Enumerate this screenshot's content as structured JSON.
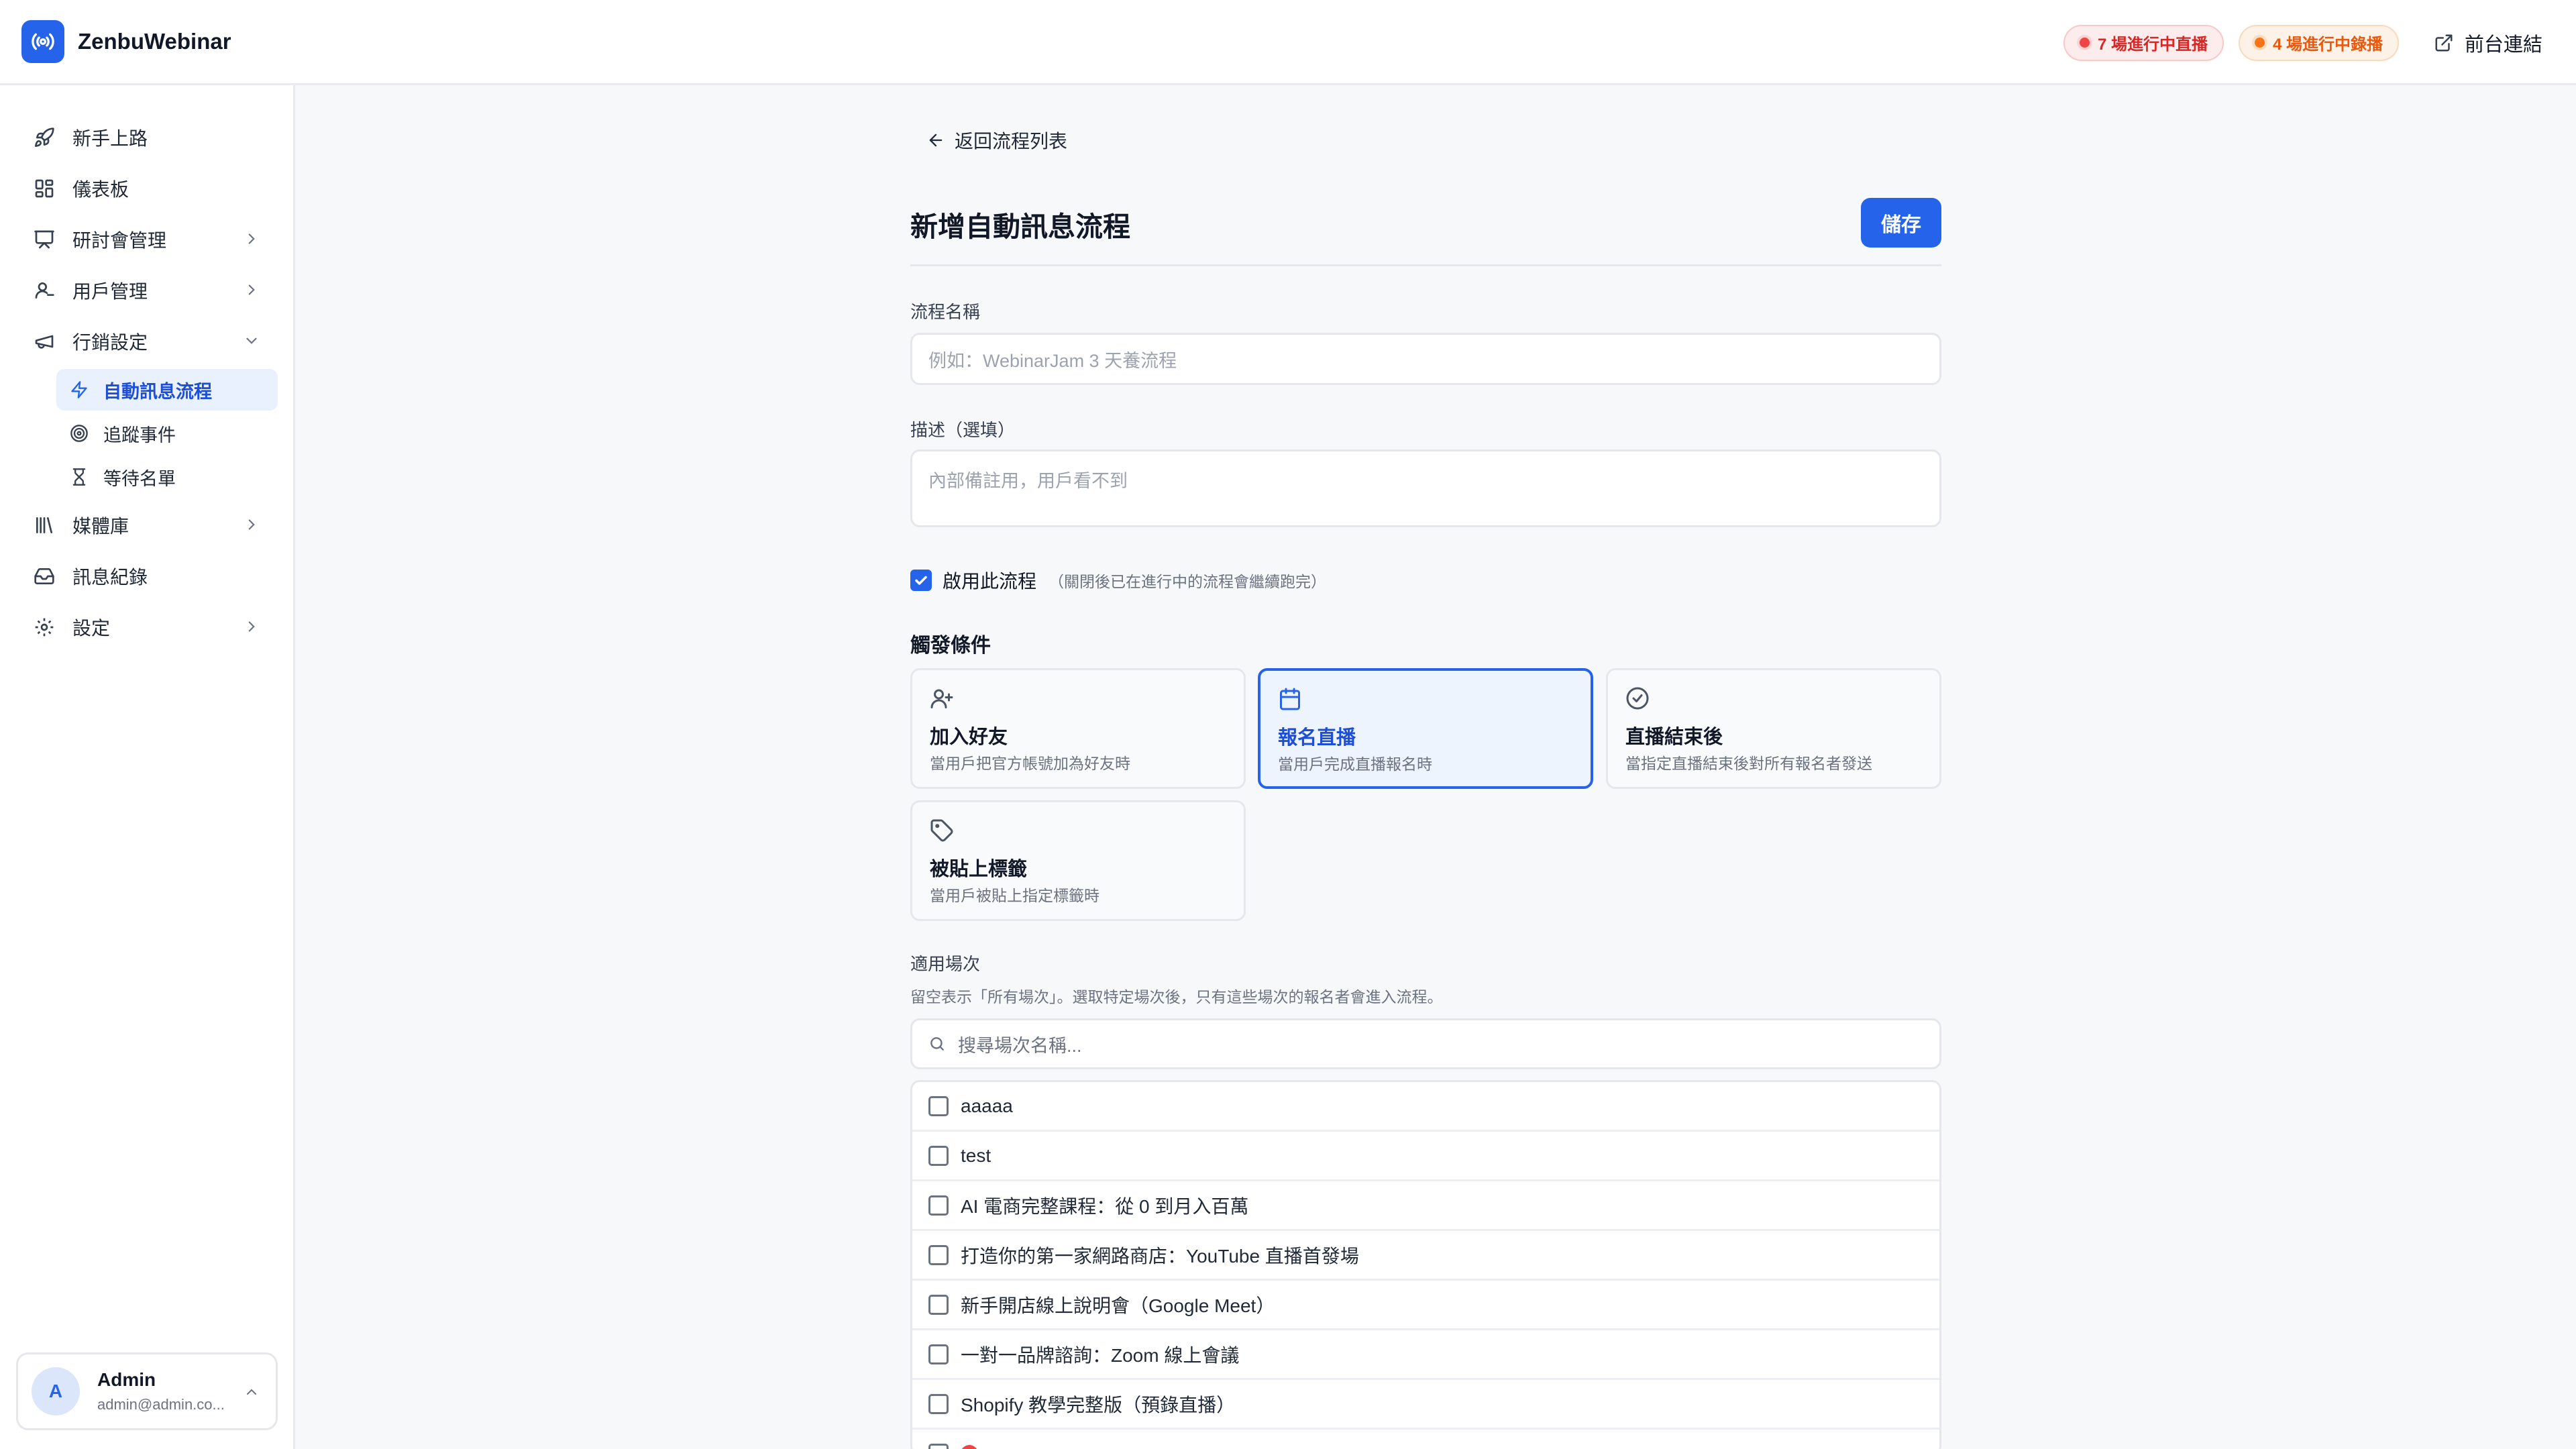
{
  "app": {
    "name": "ZenbuWebinar"
  },
  "header": {
    "live_badge": "7 場進行中直播",
    "recording_badge": "4 場進行中錄播",
    "front_link": "前台連結"
  },
  "sidebar": {
    "items": {
      "onboarding": "新手上路",
      "dashboard": "儀表板",
      "webinars": "研討會管理",
      "users": "用戶管理",
      "marketing": "行銷設定",
      "auto_flow": "自動訊息流程",
      "tracking": "追蹤事件",
      "waitlist": "等待名單",
      "media": "媒體庫",
      "messages": "訊息紀錄",
      "settings": "設定"
    },
    "user": {
      "initial": "A",
      "name": "Admin",
      "email": "admin@admin.co..."
    }
  },
  "page": {
    "back_label": "返回流程列表",
    "title": "新增自動訊息流程",
    "save_label": "儲存"
  },
  "form": {
    "name_label": "流程名稱",
    "name_placeholder": "例如：WebinarJam 3 天養流程",
    "desc_label": "描述（選填）",
    "desc_placeholder": "內部備註用，用戶看不到",
    "enable_label": "啟用此流程",
    "enable_checked": true,
    "enable_note": "（關閉後已在進行中的流程會繼續跑完）",
    "trigger_title": "觸發條件",
    "triggers": [
      {
        "icon": "user-plus-icon",
        "title": "加入好友",
        "desc": "當用戶把官方帳號加為好友時",
        "selected": false
      },
      {
        "icon": "calendar-icon",
        "title": "報名直播",
        "desc": "當用戶完成直播報名時",
        "selected": true
      },
      {
        "icon": "check-circle-icon",
        "title": "直播結束後",
        "desc": "當指定直播結束後對所有報名者發送",
        "selected": false
      },
      {
        "icon": "tag-icon",
        "title": "被貼上標籤",
        "desc": "當用戶被貼上指定標籤時",
        "selected": false
      }
    ],
    "sessions_label": "適用場次",
    "sessions_hint": "留空表示「所有場次」。選取特定場次後，只有這些場次的報名者會進入流程。",
    "search_placeholder": "搜尋場次名稱...",
    "sessions": [
      "aaaaa",
      "test",
      "AI 電商完整課程：從 0 到月入百萬",
      "打造你的第一家網路商店：YouTube 直播首發場",
      "新手開店線上說明會（Google Meet）",
      "一對一品牌諮詢：Zoom 線上會議",
      "Shopify 教學完整版（預錄直播）"
    ]
  },
  "colors": {
    "accent": "#2563eb",
    "live": "#dc2626",
    "recording": "#ea580c"
  }
}
